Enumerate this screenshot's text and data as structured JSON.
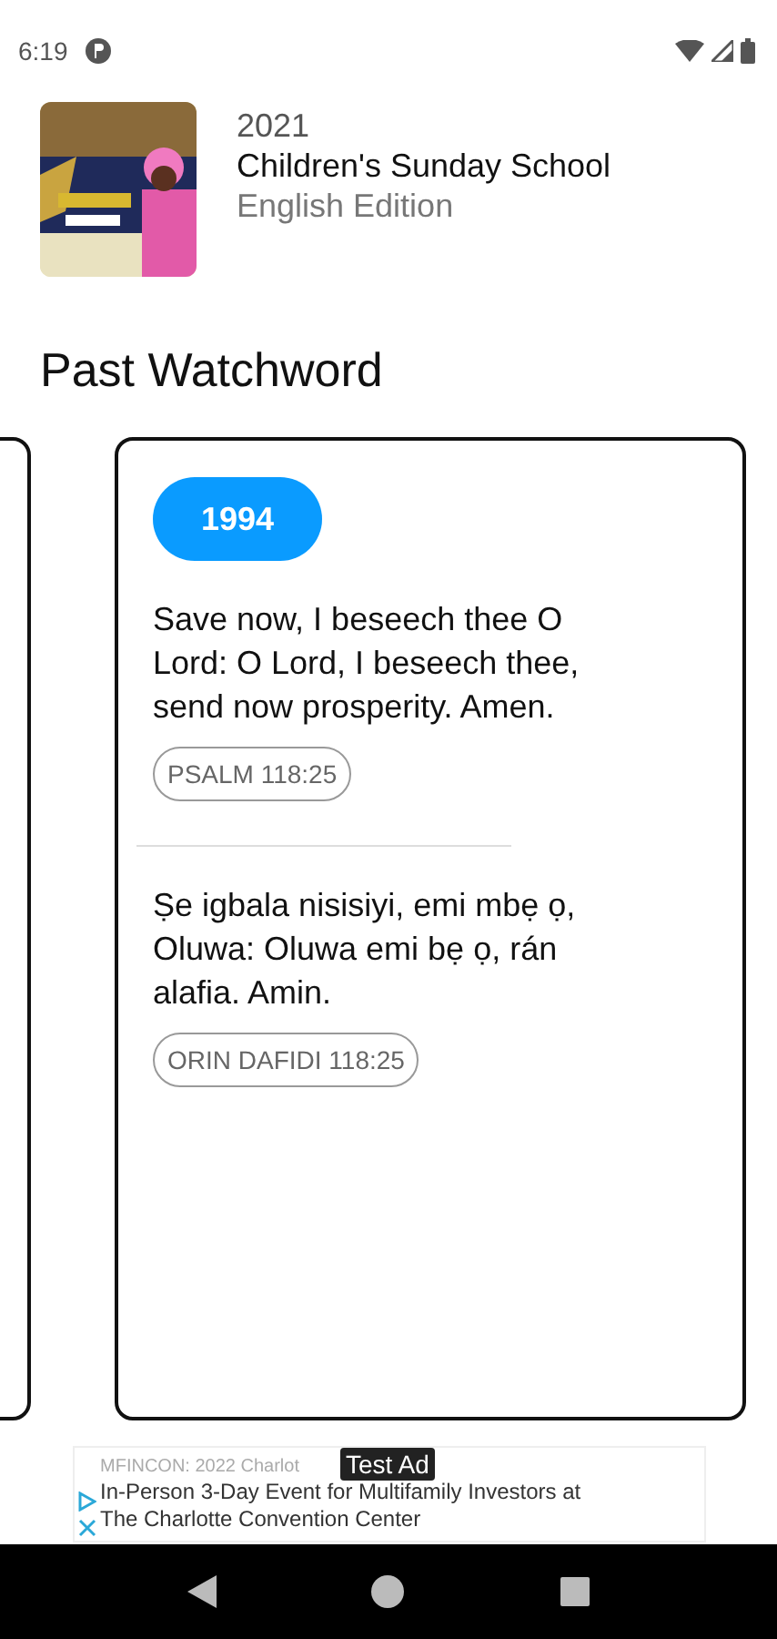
{
  "status_bar": {
    "time": "6:19"
  },
  "book": {
    "year": "2021",
    "title": "Children's Sunday School",
    "edition": "English Edition"
  },
  "section_title": "Past Watchword",
  "card": {
    "year": "1994",
    "entries": [
      {
        "text": "Save now, I beseech thee O Lord: O Lord, I beseech thee, send now prosperity. Amen.",
        "reference": "PSALM 118:25"
      },
      {
        "text": "Ṣe igbala nisisiyi, emi mbẹ ọ, Oluwa: Oluwa emi bẹ ọ, rán alafia. Amin.",
        "reference": "ORIN DAFIDI 118:25"
      }
    ]
  },
  "ad": {
    "label": "Test Ad",
    "headline": "MFINCON: 2022 Charlot",
    "body": "In-Person 3-Day Event for Multifamily Investors at The Charlotte Convention Center"
  }
}
